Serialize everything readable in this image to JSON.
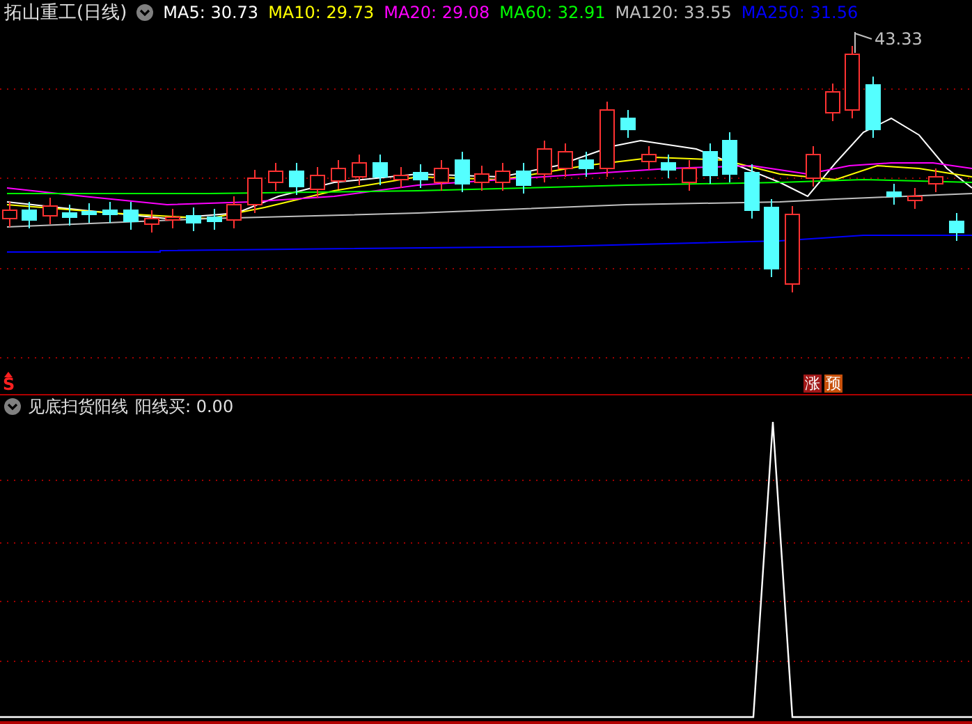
{
  "title": "拓山重工(日线)",
  "ma_lines": [
    {
      "label": "MA5: 30.73",
      "color": "#ffffff"
    },
    {
      "label": "MA10: 29.73",
      "color": "#ffff00"
    },
    {
      "label": "MA20: 29.08",
      "color": "#ff00ff"
    },
    {
      "label": "MA60: 32.91",
      "color": "#00ff00"
    },
    {
      "label": "MA120: 33.55",
      "color": "#c0c0c0"
    },
    {
      "label": "MA250: 31.56",
      "color": "#0000ff"
    }
  ],
  "price_chart": {
    "high_label": "43.33"
  },
  "signal_markers": [
    {
      "text": "S",
      "kind": "sell"
    }
  ],
  "badges": [
    {
      "text": "涨",
      "color": "#a01818"
    },
    {
      "text": "预",
      "color": "#c8500a"
    }
  ],
  "indicator": {
    "title": "见底扫货阳线",
    "value_label": "阳线买: 0.00"
  }
}
